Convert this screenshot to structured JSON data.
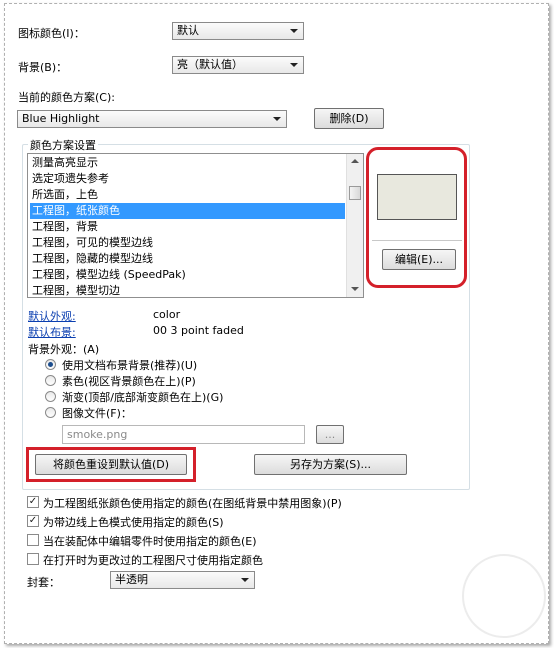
{
  "icon_color": {
    "label": "图标颜色(I)：",
    "value": "默认"
  },
  "background": {
    "label": "背景(B)：",
    "value": "亮（默认值）"
  },
  "scheme": {
    "label": "当前的颜色方案(C):",
    "value": "Blue Highlight",
    "delete_label": "删除(D)"
  },
  "settings": {
    "title": "颜色方案设置",
    "items": [
      "测量高亮显示",
      "选定项遗失参考",
      "所选面，上色",
      "工程图，纸张颜色",
      "工程图，背景",
      "工程图，可见的模型边线",
      "工程图，隐藏的模型边线",
      "工程图，模型边线 (SpeedPak)",
      "工程图，模型切边"
    ],
    "selected_index": 3,
    "swatch_color": "#e8e8de",
    "edit_label": "编辑(E)..."
  },
  "defaults": {
    "appearance_label": "默认外观:",
    "appearance_value": "color",
    "layout_label": "默认布景:",
    "layout_value": "00 3 point faded"
  },
  "bg_appearance": {
    "label": "背景外观：(A)",
    "options": [
      "使用文档布景背景(推荐)(U)",
      "素色(视区背景颜色在上)(P)",
      "渐变(顶部/底部渐变颜色在上)(G)",
      "图像文件(F)："
    ],
    "selected_index": 0,
    "file_value": "smoke.png",
    "browse_label": "..."
  },
  "buttons": {
    "reset": "将颜色重设到默认值(D)",
    "save_as": "另存为方案(S)..."
  },
  "checkboxes": [
    {
      "label": "为工程图纸张颜色使用指定的颜色(在图纸背景中禁用图象)(P)",
      "checked": true
    },
    {
      "label": "为带边线上色模式使用指定的颜色(S)",
      "checked": true
    },
    {
      "label": "当在装配体中编辑零件时使用指定的颜色(E)",
      "checked": false
    },
    {
      "label": "在打开时为更改过的工程图尺寸使用指定颜色",
      "checked": false
    }
  ],
  "envelope": {
    "label": "封套：",
    "value": "半透明"
  },
  "colors": {
    "selection": "#3399ff",
    "highlight_box": "#d4202a",
    "link": "#0b3fb0"
  }
}
